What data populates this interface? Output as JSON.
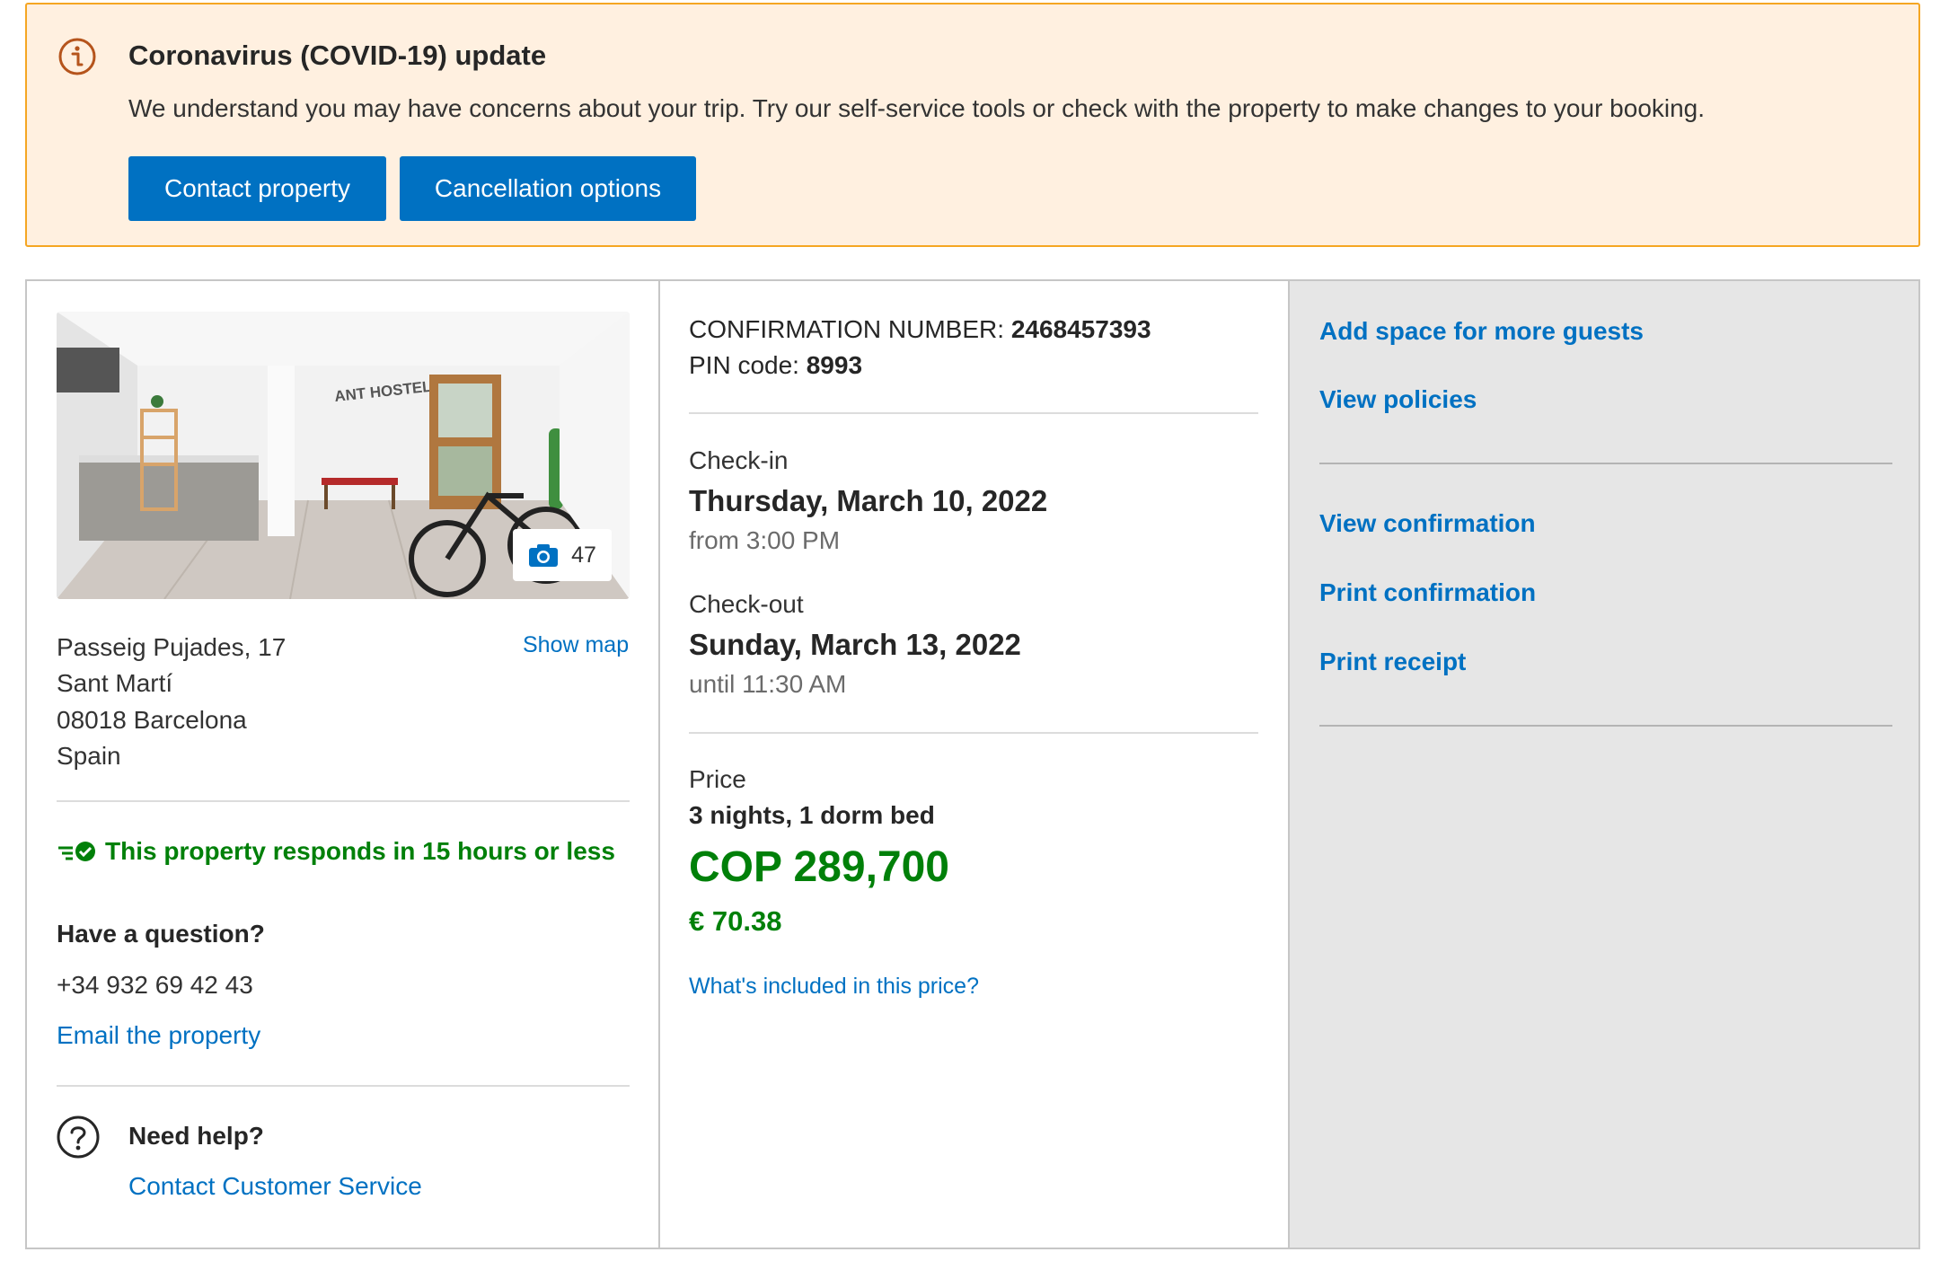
{
  "banner": {
    "title": "Coronavirus (COVID-19) update",
    "text": "We understand you may have concerns about your trip. Try our self-service tools or check with the property to make changes to your booking.",
    "contact_button": "Contact property",
    "cancellation_button": "Cancellation options",
    "icon": "info-icon"
  },
  "property": {
    "photo_count": "47",
    "photo_sign_text": "ANT HOSTEL",
    "address": [
      "Passeig Pujades, 17",
      "Sant Martí",
      "08018 Barcelona",
      "Spain"
    ],
    "show_map": "Show map",
    "responds": "This property responds in 15 hours or less",
    "question_heading": "Have a question?",
    "phone": "+34 932 69 42 43",
    "email_link": "Email the property",
    "help_heading": "Need help?",
    "customer_service_link": "Contact Customer Service"
  },
  "booking": {
    "confirmation_label": "CONFIRMATION NUMBER:",
    "confirmation_number": "2468457393",
    "pin_label": "PIN code:",
    "pin": "8993",
    "checkin_label": "Check-in",
    "checkin_date": "Thursday, March 10, 2022",
    "checkin_time": "from 3:00 PM",
    "checkout_label": "Check-out",
    "checkout_date": "Sunday, March 13, 2022",
    "checkout_time": "until 11:30 AM",
    "price_label": "Price",
    "price_detail": "3 nights, 1 dorm bed",
    "price_cop": "COP 289,700",
    "price_eur": "€ 70.38",
    "price_link": "What's included in this price?"
  },
  "actions": {
    "add_space": "Add space for more guests",
    "view_policies": "View policies",
    "view_confirmation": "View confirmation",
    "print_confirmation": "Print confirmation",
    "print_receipt": "Print receipt"
  },
  "colors": {
    "primary": "#0071c2",
    "success": "#008009",
    "banner_bg": "#fff0e0",
    "banner_border": "#f5a623",
    "sidebar_bg": "#e6e6e6"
  }
}
